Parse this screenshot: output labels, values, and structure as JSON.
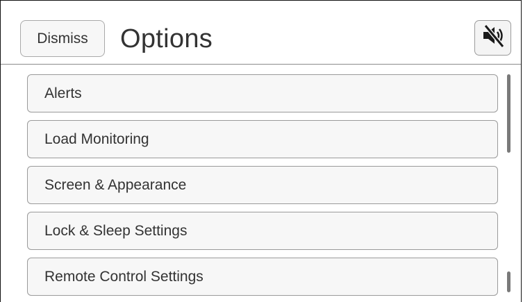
{
  "header": {
    "dismiss_label": "Dismiss",
    "title": "Options",
    "mute_icon": "speaker-muted-icon"
  },
  "menu": {
    "items": [
      {
        "label": "Alerts"
      },
      {
        "label": "Load Monitoring"
      },
      {
        "label": "Screen & Appearance"
      },
      {
        "label": "Lock & Sleep Settings"
      },
      {
        "label": "Remote Control Settings"
      }
    ]
  },
  "colors": {
    "background": "#ffffff",
    "button_fill": "#f7f7f7",
    "border": "#9a9a9a",
    "text": "#333333"
  }
}
